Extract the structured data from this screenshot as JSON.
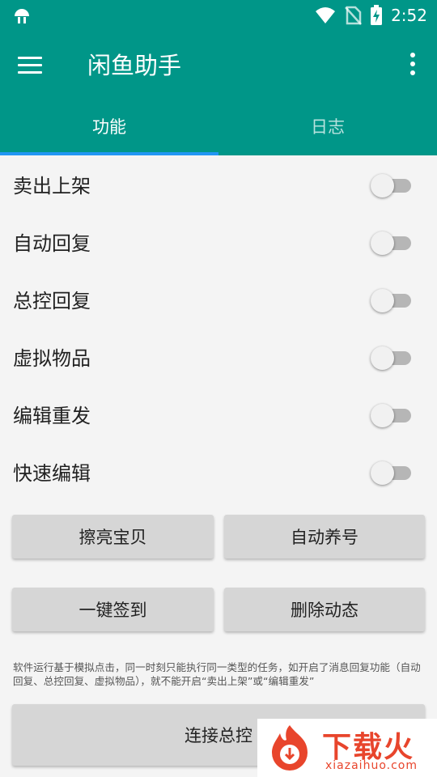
{
  "status_bar": {
    "time": "2:52",
    "icons": [
      "android-debug-icon",
      "wifi-icon",
      "no-sim-icon",
      "battery-charging-icon"
    ]
  },
  "app_bar": {
    "title": "闲鱼助手",
    "icons": [
      "menu-icon",
      "more-vert-icon"
    ]
  },
  "tabs": [
    {
      "label": "功能",
      "selected": true
    },
    {
      "label": "日志",
      "selected": false
    }
  ],
  "toggles": [
    {
      "label": "卖出上架",
      "on": false
    },
    {
      "label": "自动回复",
      "on": false
    },
    {
      "label": "总控回复",
      "on": false
    },
    {
      "label": "虚拟物品",
      "on": false
    },
    {
      "label": "编辑重发",
      "on": false
    },
    {
      "label": "快速编辑",
      "on": false
    }
  ],
  "buttons": {
    "polish": "擦亮宝贝",
    "auto_raise": "自动养号",
    "sign_in": "一键签到",
    "delete_feed": "删除动态",
    "connect": "连接总控"
  },
  "notice": "软件运行基于模拟点击，同一时刻只能执行同一类型的任务，如开启了消息回复功能（自动回复、总控回复、虚拟物品），就不能开启“卖出上架”或“编辑重发”",
  "watermark": {
    "title": "下载火",
    "subtitle": "xiazaihuo.com"
  },
  "colors": {
    "primary": "#009688",
    "tab_indicator": "#2196f3",
    "button_bg": "#d6d6d6",
    "watermark": "#e8452c"
  }
}
